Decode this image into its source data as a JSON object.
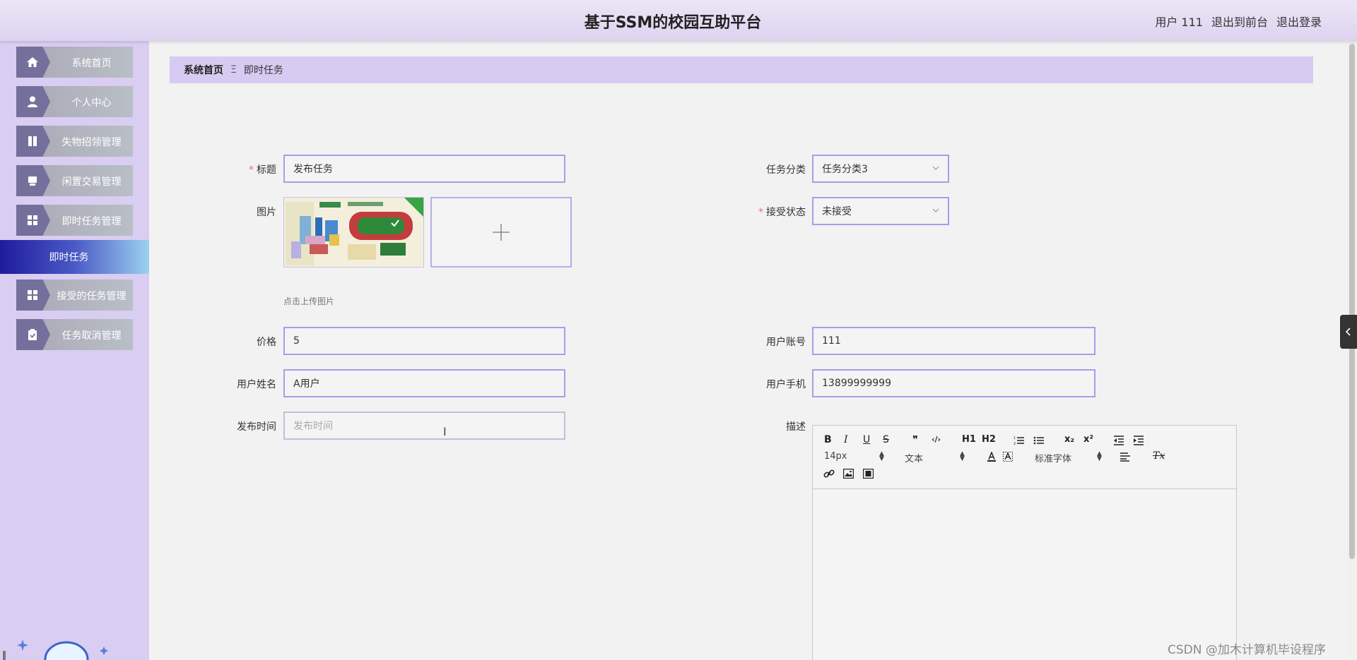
{
  "header": {
    "title": "基于SSM的校园互助平台",
    "user": "用户 111",
    "to_front": "退出到前台",
    "logout": "退出登录"
  },
  "sidebar": {
    "items": [
      {
        "label": "系统首页",
        "icon": "home-icon"
      },
      {
        "label": "个人中心",
        "icon": "user-icon"
      },
      {
        "label": "失物招领管理",
        "icon": "book-icon"
      },
      {
        "label": "闲置交易管理",
        "icon": "box-icon"
      },
      {
        "label": "即时任务管理",
        "icon": "grid-icon"
      },
      {
        "label": "接受的任务管理",
        "icon": "grid-icon"
      },
      {
        "label": "任务取消管理",
        "icon": "clipboard-icon"
      }
    ],
    "active": "即时任务"
  },
  "breadcrumb": {
    "home": "系统首页",
    "separator": "Ξ",
    "current": "即时任务"
  },
  "form": {
    "title_label": "标题",
    "title_value": "发布任务",
    "image_label": "图片",
    "image_hint": "点击上传图片",
    "price_label": "价格",
    "price_value": "5",
    "username_label": "用户姓名",
    "username_value": "A用户",
    "publish_time_label": "发布时间",
    "publish_time_placeholder": "发布时间",
    "category_label": "任务分类",
    "category_value": "任务分类3",
    "accept_status_label": "接受状态",
    "accept_status_value": "未接受",
    "account_label": "用户账号",
    "account_value": "111",
    "phone_label": "用户手机",
    "phone_value": "13899999999",
    "desc_label": "描述",
    "required_mark": "*"
  },
  "editor": {
    "bold": "B",
    "italic": "I",
    "underline": "U",
    "strike": "S",
    "quote": "❞",
    "code": "‹/›",
    "h1": "H1",
    "h2": "H2",
    "sub": "x₂",
    "sup": "x²",
    "size": "14px",
    "text_type": "文本",
    "font": "标准字体",
    "clear": "Tx"
  },
  "watermark": "CSDN @加木计算机毕设程序",
  "colors": {
    "accent": "#a79ee8",
    "sidebar_bg": "#d9cdf2",
    "active": "#2a2aa8"
  }
}
